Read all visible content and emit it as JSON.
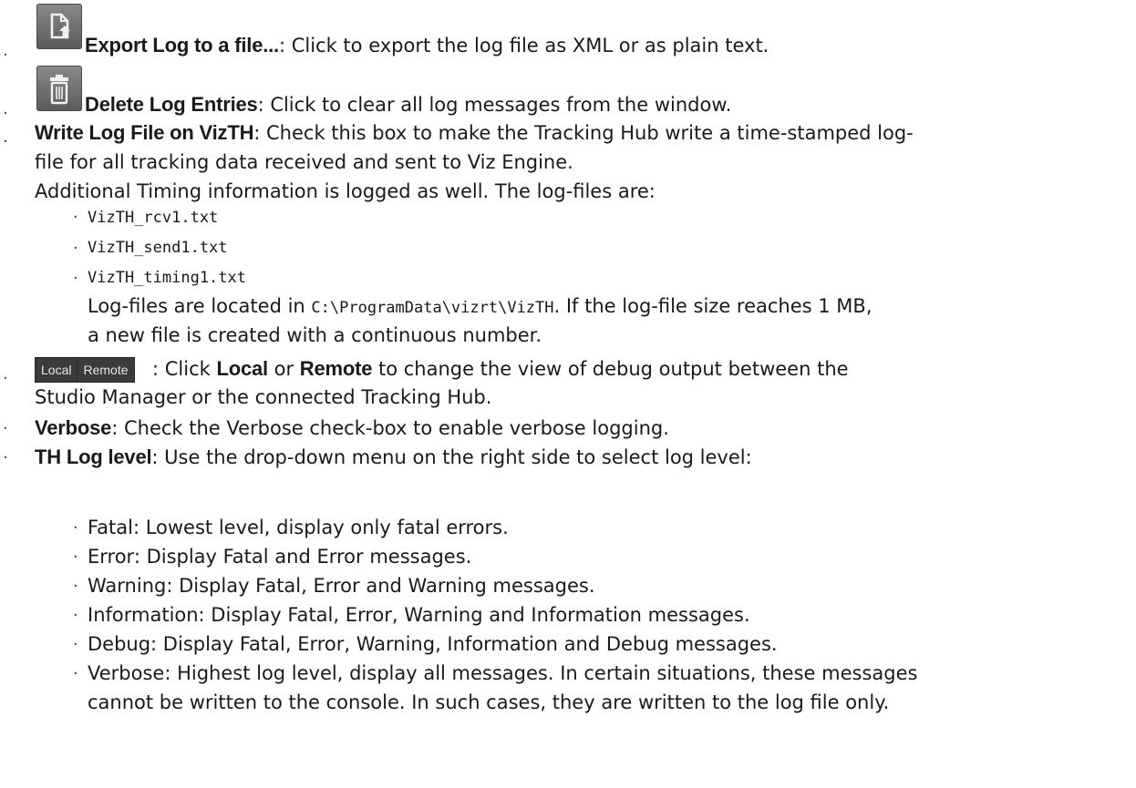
{
  "export": {
    "term": "Export Log to a file...",
    "desc": ": Click to export the log file as XML or as plain text.",
    "icon": "export-file-icon"
  },
  "delete": {
    "term": "Delete Log Entries",
    "desc": ": Click to clear all log messages from the window.",
    "icon": "trash-icon"
  },
  "write": {
    "term": "Write Log File on VizTH",
    "desc1": ": Check this box to make the Tracking Hub write a time-stamped log-",
    "desc2": "file for all tracking data received and sent to Viz Engine.",
    "desc3": "Additional Timing information is logged as well. The log-files are:",
    "files": [
      "VizTH_rcv1.txt",
      "VizTH_send1.txt",
      "VizTH_timing1.txt"
    ],
    "loc_pre": "Log-files are located in ",
    "loc_path": "C:\\ProgramData\\vizrt\\VizTH",
    "loc_post": ". If the log-file size reaches 1 MB,",
    "loc_line2": "a new file is created with a continuous number."
  },
  "localremote": {
    "local_btn": "Local",
    "remote_btn": "Remote",
    "pre": " : Click ",
    "local": "Local",
    "or": " or ",
    "remote": "Remote",
    "post": " to change the view of debug output between the",
    "line2": "Studio Manager or the connected Tracking Hub."
  },
  "verbose": {
    "term": "Verbose",
    "desc": ": Check the Verbose check-box to enable verbose logging."
  },
  "thlog": {
    "term": "TH Log level",
    "desc": ": Use the drop-down menu on the right side to select log level:",
    "levels": [
      "Fatal: Lowest level, display only fatal errors.",
      "Error: Display Fatal and Error messages.",
      "Warning: Display Fatal, Error and Warning messages.",
      "Information: Display Fatal, Error, Warning and Information messages.",
      "Debug: Display Fatal, Error, Warning, Information and Debug messages.",
      "Verbose: Highest log level, display all messages. In certain situations, these messages"
    ],
    "levels_cont": "cannot be written to the console. In such cases, they are written to the log file only."
  }
}
